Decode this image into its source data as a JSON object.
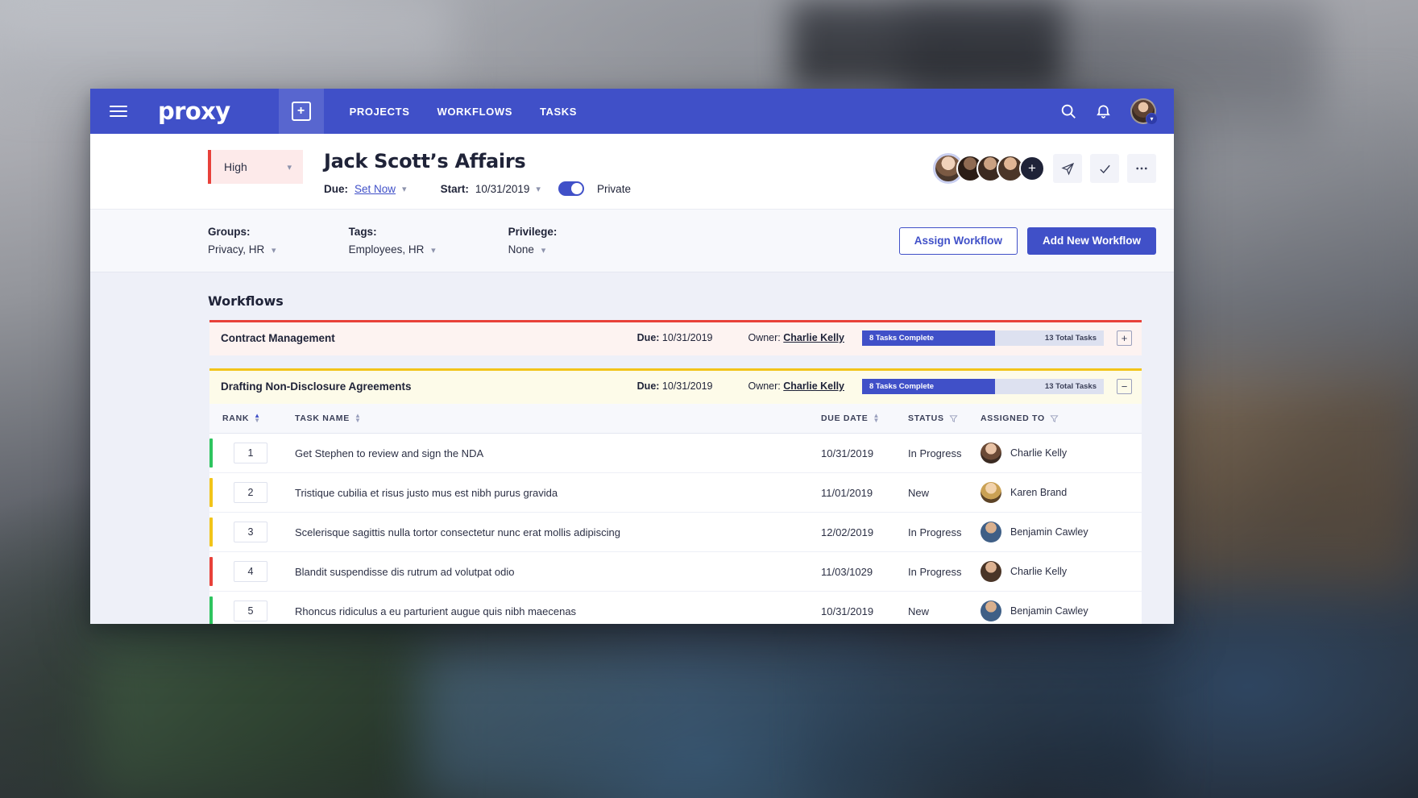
{
  "topnav": {
    "menu_icon": "hamburger-icon",
    "brand": "proxy",
    "add_icon": "plus-square-icon",
    "links": [
      {
        "label": "PROJECTS"
      },
      {
        "label": "WORKFLOWS"
      },
      {
        "label": "TASKS"
      }
    ],
    "search_icon": "search-icon",
    "bell_icon": "bell-icon",
    "avatar_caret": "▾",
    "bg_color": "#4050c8"
  },
  "header": {
    "priority": "High",
    "priority_caret": "⌄",
    "priority_color": "#e8413a",
    "title": "Jack Scott’s Affairs",
    "due_label": "Due:",
    "due_value": "Set Now",
    "start_label": "Start:",
    "start_value": "10/31/2019",
    "privacy_label": "Private",
    "privacy_on": true,
    "add_member_icon": "+",
    "send_icon": "send-icon",
    "check_icon": "check-icon",
    "more_icon": "ellipsis-icon"
  },
  "filters": {
    "groups_label": "Groups:",
    "groups_value": "Privacy, HR",
    "tags_label": "Tags:",
    "tags_value": "Employees, HR",
    "privilege_label": "Privilege:",
    "privilege_value": "None",
    "assign_button": "Assign Workflow",
    "add_button": "Add New Workflow"
  },
  "workflows_section": {
    "title": "Workflows",
    "items": [
      {
        "name": "Contract Management",
        "accent": "#e8413a",
        "due_label": "Due:",
        "due_value": "10/31/2019",
        "owner_label": "Owner:",
        "owner_value": "Charlie Kelly",
        "progress_text": "8 Tasks Complete",
        "total_text": "13 Total Tasks",
        "progress_pct": 55,
        "expanded": false,
        "toggle_icon": "plus-square-icon"
      },
      {
        "name": "Drafting Non-Disclosure Agreements",
        "accent": "#f2c41a",
        "due_label": "Due:",
        "due_value": "10/31/2019",
        "owner_label": "Owner:",
        "owner_value": "Charlie Kelly",
        "progress_text": "8 Tasks Complete",
        "total_text": "13 Total Tasks",
        "progress_pct": 55,
        "expanded": true,
        "toggle_icon": "minus-square-icon"
      }
    ]
  },
  "task_table": {
    "columns": [
      {
        "label": "RANK",
        "control": "sort"
      },
      {
        "label": "TASK NAME",
        "control": "sort"
      },
      {
        "label": "DUE DATE",
        "control": "sort"
      },
      {
        "label": "STATUS",
        "control": "filter"
      },
      {
        "label": "ASSIGNED TO",
        "control": "filter"
      }
    ],
    "rows": [
      {
        "rank": "1",
        "bar_color": "#2ec45f",
        "name": "Get Stephen to review and sign the NDA",
        "due": "10/31/2019",
        "status": "In Progress",
        "assignee": "Charlie Kelly"
      },
      {
        "rank": "2",
        "bar_color": "#f2c41a",
        "name": "Tristique cubilia et risus justo mus est nibh purus gravida",
        "due": "11/01/2019",
        "status": "New",
        "assignee": "Karen Brand"
      },
      {
        "rank": "3",
        "bar_color": "#f2c41a",
        "name": "Scelerisque sagittis nulla tortor consectetur nunc erat mollis adipiscing",
        "due": "12/02/2019",
        "status": "In Progress",
        "assignee": "Benjamin Cawley"
      },
      {
        "rank": "4",
        "bar_color": "#e8413a",
        "name": "Blandit suspendisse dis rutrum ad volutpat odio",
        "due": "11/03/1029",
        "status": "In Progress",
        "assignee": "Charlie Kelly"
      },
      {
        "rank": "5",
        "bar_color": "#2ec45f",
        "name": "Rhoncus ridiculus a eu parturient augue quis nibh maecenas",
        "due": "10/31/2019",
        "status": "New",
        "assignee": "Benjamin Cawley"
      }
    ]
  }
}
